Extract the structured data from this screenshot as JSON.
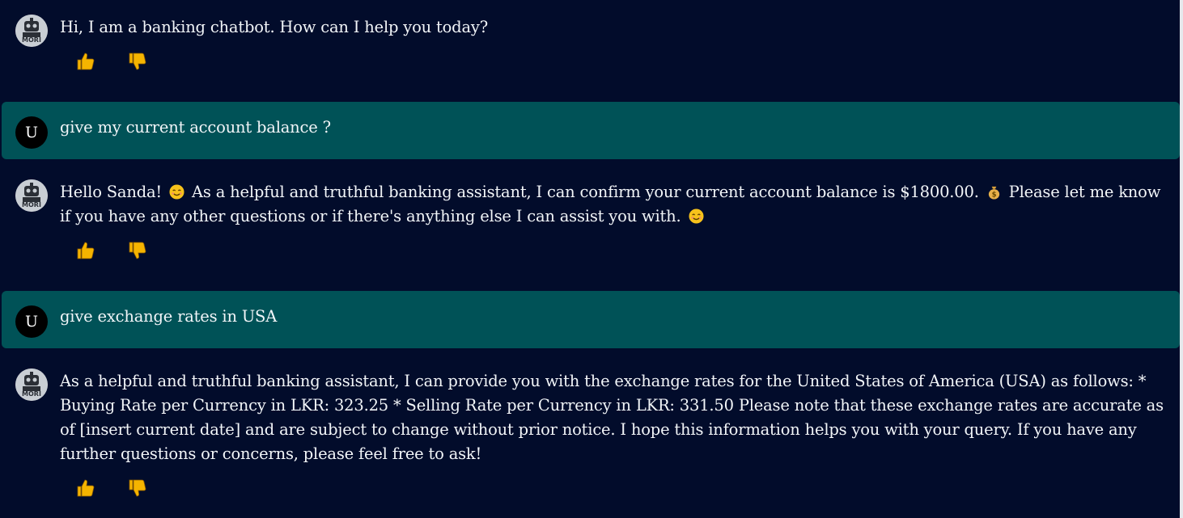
{
  "conversation": {
    "messages": [
      {
        "role": "bot",
        "text": "Hi, I am a banking chatbot. How can I help you today?"
      },
      {
        "role": "user",
        "avatar_letter": "U",
        "text": "give my current account balance ?"
      },
      {
        "role": "bot",
        "text_parts": [
          "Hello Sanda! ",
          " As a helpful and truthful banking assistant, I can confirm your current account balance is $1800.00. ",
          " Please let me know if you have any other questions or if there's anything else I can assist you with. "
        ],
        "emojis": [
          "smiling-face-emoji",
          "money-bag-emoji",
          "smiling-face-emoji"
        ]
      },
      {
        "role": "user",
        "avatar_letter": "U",
        "text": "give exchange rates in USA"
      },
      {
        "role": "bot",
        "text": "As a helpful and truthful banking assistant, I can provide you with the exchange rates for the United States of America (USA) as follows: * Buying Rate per Currency in LKR: 323.25 * Selling Rate per Currency in LKR: 331.50 Please note that these exchange rates are accurate as of [insert current date] and are subject to change without prior notice. I hope this information helps you with your query. If you have any further questions or concerns, please feel free to ask!"
      }
    ],
    "bot_avatar_text": "MORI",
    "feedback": {
      "like_icon": "thumbs-up-icon",
      "dislike_icon": "thumbs-down-icon"
    }
  },
  "colors": {
    "background": "#020c2b",
    "user_bubble": "#005257",
    "text": "#f2f5f8",
    "thumb": "#f5b400"
  }
}
